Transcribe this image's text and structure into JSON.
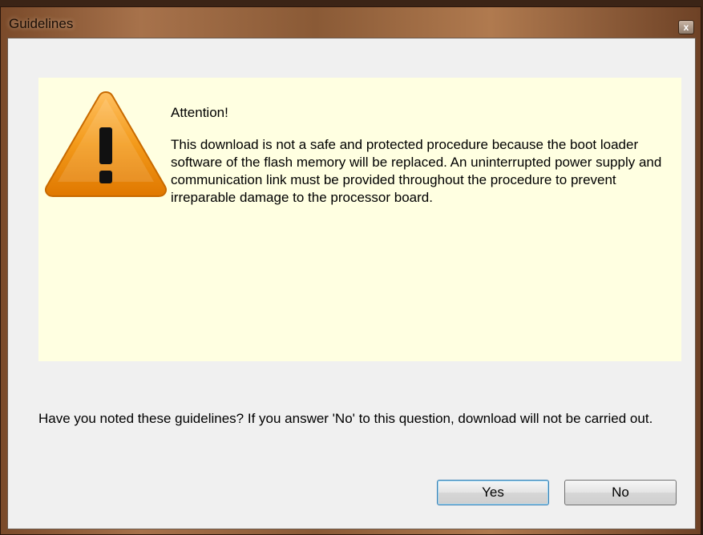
{
  "window": {
    "title": "Guidelines",
    "close_label": "x"
  },
  "notice": {
    "icon": "warning-triangle-icon",
    "heading": "Attention!",
    "body": "This download is not a safe and protected procedure because the boot loader software of the flash memory will be replaced. An uninterrupted power supply and communication link must be provided throughout the procedure to prevent irreparable damage to the processor board."
  },
  "question": "Have you noted these guidelines? If you answer 'No' to this question, download will not be carried out.",
  "buttons": {
    "yes": "Yes",
    "no": "No"
  },
  "colors": {
    "notice_background": "#ffffe1",
    "dialog_background": "#f0f0f0",
    "warning_orange": "#f39200"
  }
}
